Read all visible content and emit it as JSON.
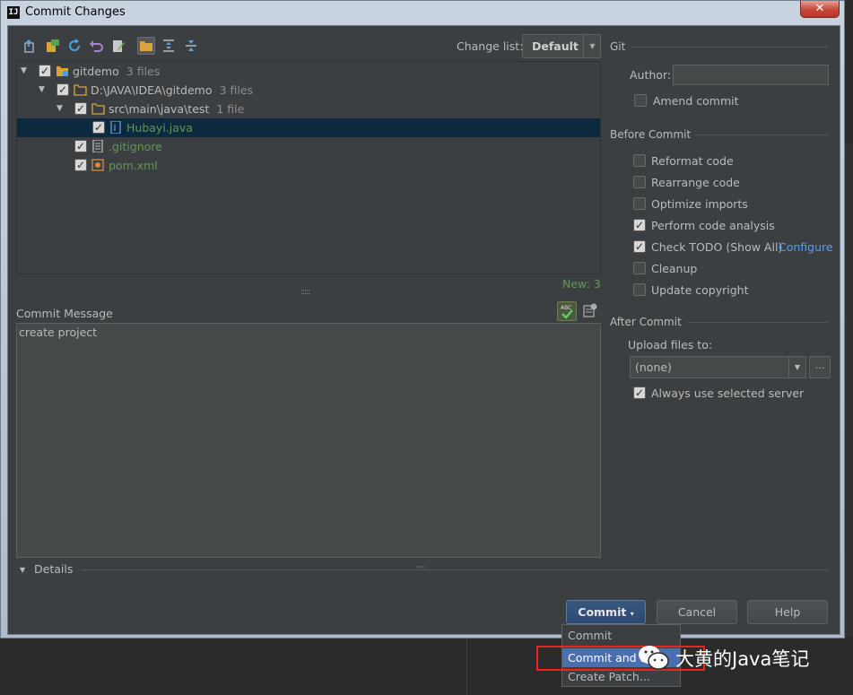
{
  "window": {
    "title": "Commit Changes",
    "close_label": "✕"
  },
  "toolbar": {
    "change_list_label": "Change list:",
    "change_list_value": "Default"
  },
  "tree": {
    "rows": [
      {
        "name": "gitdemo",
        "count": "3 files"
      },
      {
        "name": "D:\\JAVA\\IDEA\\gitdemo",
        "count": "3 files"
      },
      {
        "name": "src\\main\\java\\test",
        "count": "1 file"
      },
      {
        "name": "Hubayi.java",
        "count": ""
      },
      {
        "name": ".gitignore",
        "count": ""
      },
      {
        "name": "pom.xml",
        "count": ""
      }
    ],
    "new_count": "New: 3"
  },
  "commit_message": {
    "label": "Commit Message",
    "text": "create project"
  },
  "details_label": "Details",
  "git": {
    "section_title": "Git",
    "author_label": "Author:",
    "author_value": "",
    "amend_label": "Amend commit"
  },
  "before_commit": {
    "section_title": "Before Commit",
    "options": [
      {
        "label": "Reformat code",
        "checked": false
      },
      {
        "label": "Rearrange code",
        "checked": false
      },
      {
        "label": "Optimize imports",
        "checked": false
      },
      {
        "label": "Perform code analysis",
        "checked": true
      },
      {
        "label": "Check TODO (Show All)",
        "checked": true
      },
      {
        "label": "Cleanup",
        "checked": false
      },
      {
        "label": "Update copyright",
        "checked": false
      }
    ],
    "configure_link": "Configure"
  },
  "after_commit": {
    "section_title": "After Commit",
    "upload_label": "Upload files to:",
    "upload_value": "(none)",
    "browse_label": "...",
    "always_use_label": "Always use selected server"
  },
  "buttons": {
    "commit": "Commit",
    "cancel": "Cancel",
    "help": "Help"
  },
  "commit_menu": {
    "items": [
      "Commit",
      "Commit and Push...",
      "Create Patch..."
    ],
    "visible_items": [
      "Commit",
      "Commit and P",
      "Create Patch..."
    ],
    "selected_index": 1
  },
  "watermark": {
    "text": "大黄的Java笔记"
  },
  "colors": {
    "panel_bg": "#3c3f41",
    "selection": "#0d293e",
    "new_file_green": "#629755",
    "link_blue": "#589df6",
    "menu_highlight": "#4b6eaf",
    "annotation_red": "#e8261f"
  }
}
